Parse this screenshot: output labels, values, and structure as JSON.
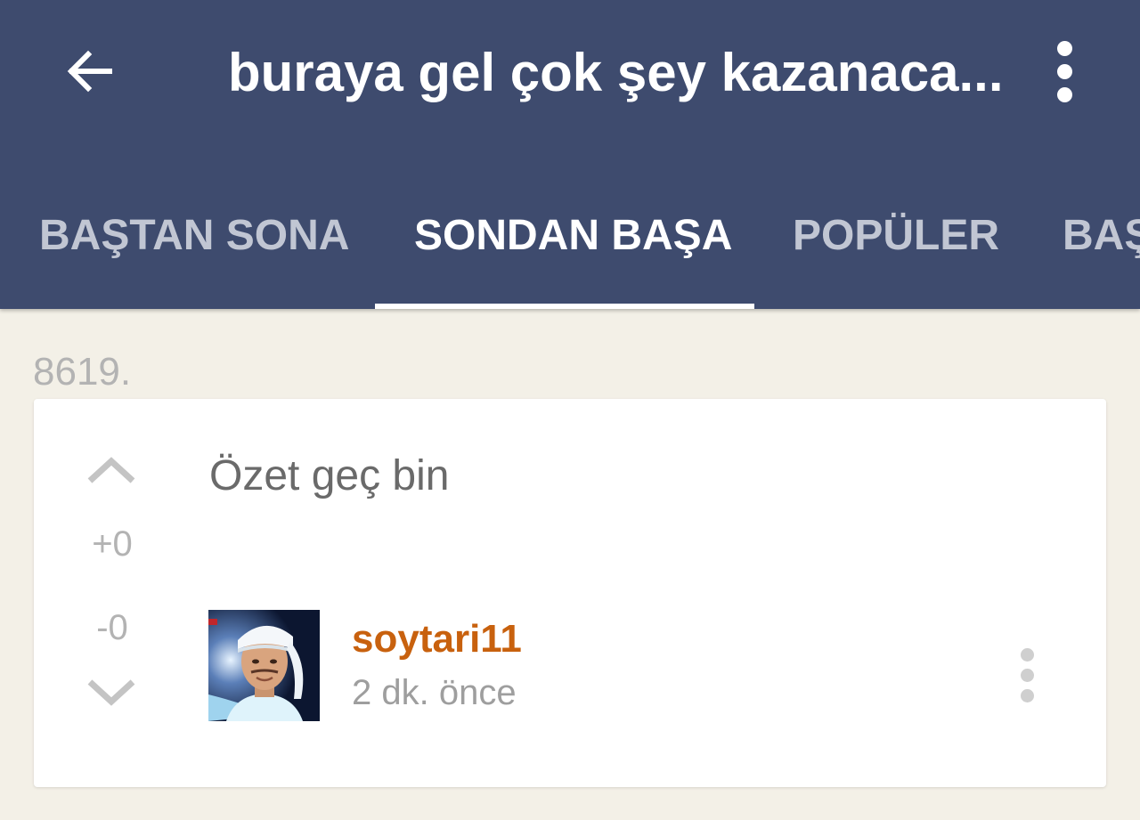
{
  "header": {
    "title": "buraya gel çok şey kazanaca...",
    "back_icon": "arrow-left-icon",
    "menu_icon": "more-vert-icon"
  },
  "tabs": [
    {
      "label": "BAŞTAN SONA",
      "active": false
    },
    {
      "label": "SONDAN BAŞA",
      "active": true
    },
    {
      "label": "POPÜLER",
      "active": false
    },
    {
      "label": "BAŞ",
      "active": false
    }
  ],
  "entry": {
    "number": "8619.",
    "text": "Özet geç bin",
    "votes": {
      "plus": "+0",
      "minus": "-0",
      "up_icon": "chevron-up-icon",
      "down_icon": "chevron-down-icon"
    },
    "author": "soytari11",
    "time": "2 dk. önce",
    "menu_icon": "more-vert-icon"
  },
  "colors": {
    "appbar": "#3e4b6e",
    "background": "#f3f0e7",
    "author": "#c8610e",
    "tab_inactive": "#c1c6d3",
    "muted_text": "#b3b3b3"
  }
}
